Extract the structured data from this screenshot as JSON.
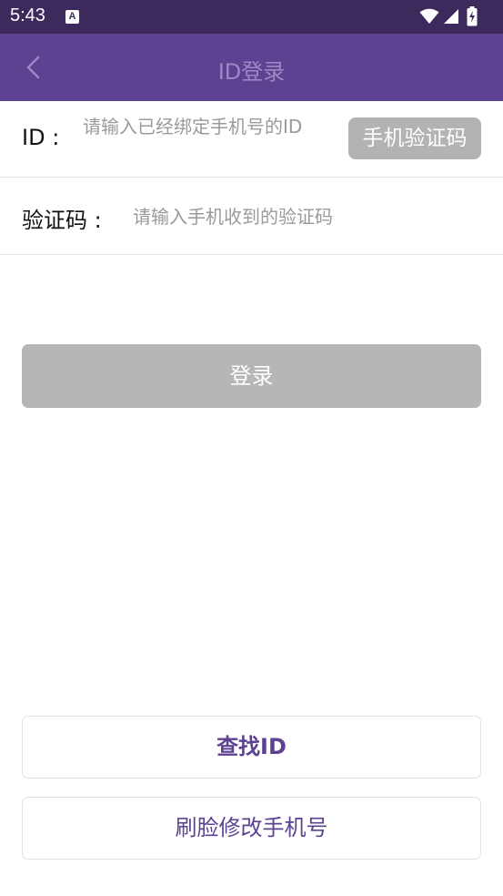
{
  "status_bar": {
    "time": "5:43",
    "notification_letter": "A",
    "icons": [
      "wifi-icon",
      "cellular-signal-icon",
      "battery-charging-icon"
    ]
  },
  "header": {
    "title": "ID登录",
    "back_icon": "chevron-left-icon",
    "background_color": "#5e4292"
  },
  "form": {
    "id_label": "ID :",
    "id_placeholder": "请输入已经绑定手机号的ID",
    "sms_button_label": "手机验证码",
    "code_label": "验证码 :",
    "code_placeholder": "请输入手机收到的验证码"
  },
  "actions": {
    "login_label": "登录",
    "find_id_label": "查找ID",
    "face_change_phone_label": "刷脸修改手机号"
  },
  "colors": {
    "status_bar": "#3d2a5c",
    "accent": "#5e4292",
    "disabled_button": "#b6b6b6"
  }
}
